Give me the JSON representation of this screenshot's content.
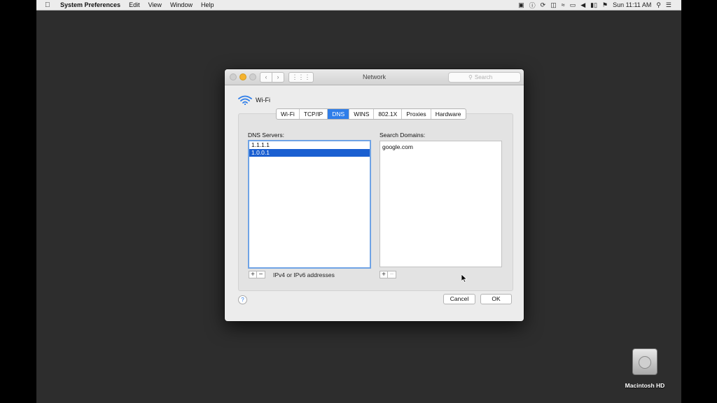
{
  "menubar": {
    "app_name": "System Preferences",
    "items": [
      "Edit",
      "View",
      "Window",
      "Help"
    ],
    "clock": "Sun 11:11 AM"
  },
  "window": {
    "title": "Network",
    "search_placeholder": "Search"
  },
  "interface": {
    "name": "Wi-Fi"
  },
  "tabs": [
    {
      "label": "Wi-Fi",
      "selected": false
    },
    {
      "label": "TCP/IP",
      "selected": false
    },
    {
      "label": "DNS",
      "selected": true
    },
    {
      "label": "WINS",
      "selected": false
    },
    {
      "label": "802.1X",
      "selected": false
    },
    {
      "label": "Proxies",
      "selected": false
    },
    {
      "label": "Hardware",
      "selected": false
    }
  ],
  "dns": {
    "servers_label": "DNS Servers:",
    "servers": [
      "1.1.1.1",
      "1.0.0.1"
    ],
    "selected_server": "1.0.0.1",
    "hint": "IPv4 or IPv6 addresses",
    "domains_label": "Search Domains:",
    "domains": [
      "google.com"
    ]
  },
  "buttons": {
    "add": "+",
    "remove": "−",
    "help": "?",
    "cancel": "Cancel",
    "ok": "OK"
  },
  "desktop": {
    "drive_label": "Macintosh HD"
  },
  "colors": {
    "accent": "#2f7ee9",
    "selection": "#1a5fd1",
    "desktop": "#2d2d2d"
  }
}
